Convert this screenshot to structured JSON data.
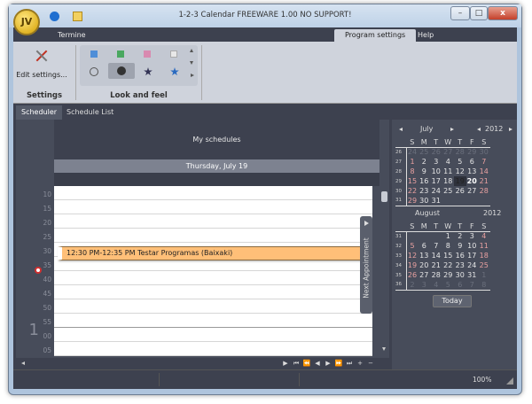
{
  "window": {
    "title": "1-2-3 Calendar FREEWARE 1.00 NO SUPPORT!",
    "logo_text": "JV",
    "minimize": "–",
    "maximize": "□",
    "close": "x"
  },
  "menu": {
    "tabs": [
      "Termine",
      "Program settings",
      "Help"
    ],
    "active": "Program settings"
  },
  "ribbon": {
    "edit_settings": "Edit settings...",
    "settings_group": "Settings",
    "look_group": "Look and feel"
  },
  "view_tabs": [
    "Scheduler",
    "Schedule List"
  ],
  "scheduler": {
    "header": "My schedules",
    "date": "Thursday, July 19",
    "hour_label": "1",
    "time_slots": [
      "10",
      "15",
      "20",
      "25",
      "30",
      "35",
      "40",
      "45",
      "50",
      "55",
      "00",
      "05"
    ],
    "appointment": {
      "text": "12:30 PM-12:35 PM Testar Programas (Baixaki)",
      "color": "#ffbf78"
    },
    "next_appointment": "Next Appointment"
  },
  "nav_buttons": [
    "▶",
    "⏮",
    "⏪",
    "◀",
    "▶",
    "⏩",
    "⏭",
    "+",
    "−"
  ],
  "mini_calendars": [
    {
      "month": "July",
      "year": "2012",
      "weekdays": [
        "S",
        "M",
        "T",
        "W",
        "T",
        "F",
        "S"
      ],
      "weeks": [
        {
          "week": "26",
          "days": [
            "24",
            "25",
            "26",
            "27",
            "28",
            "29",
            "30"
          ]
        },
        {
          "week": "27",
          "days": [
            "1",
            "2",
            "3",
            "4",
            "5",
            "6",
            "7"
          ]
        },
        {
          "week": "28",
          "days": [
            "8",
            "9",
            "10",
            "11",
            "12",
            "13",
            "14"
          ]
        },
        {
          "week": "29",
          "days": [
            "15",
            "16",
            "17",
            "18",
            "19",
            "20",
            "21"
          ]
        },
        {
          "week": "30",
          "days": [
            "22",
            "23",
            "24",
            "25",
            "26",
            "27",
            "28"
          ]
        },
        {
          "week": "31",
          "days": [
            "29",
            "30",
            "31",
            "",
            "",
            "",
            ""
          ]
        }
      ],
      "today": "19",
      "selected": "20"
    },
    {
      "month": "August",
      "year": "2012",
      "weekdays": [
        "S",
        "M",
        "T",
        "W",
        "T",
        "F",
        "S"
      ],
      "weeks": [
        {
          "week": "31",
          "days": [
            "",
            "",
            "",
            "1",
            "2",
            "3",
            "4"
          ]
        },
        {
          "week": "32",
          "days": [
            "5",
            "6",
            "7",
            "8",
            "9",
            "10",
            "11"
          ]
        },
        {
          "week": "33",
          "days": [
            "12",
            "13",
            "14",
            "15",
            "16",
            "17",
            "18"
          ]
        },
        {
          "week": "34",
          "days": [
            "19",
            "20",
            "21",
            "22",
            "23",
            "24",
            "25"
          ]
        },
        {
          "week": "35",
          "days": [
            "26",
            "27",
            "28",
            "29",
            "30",
            "31",
            "1"
          ]
        },
        {
          "week": "36",
          "days": [
            "2",
            "3",
            "4",
            "5",
            "6",
            "7",
            "8"
          ]
        }
      ]
    }
  ],
  "today_button": "Today",
  "status": {
    "zoom": "100%"
  }
}
